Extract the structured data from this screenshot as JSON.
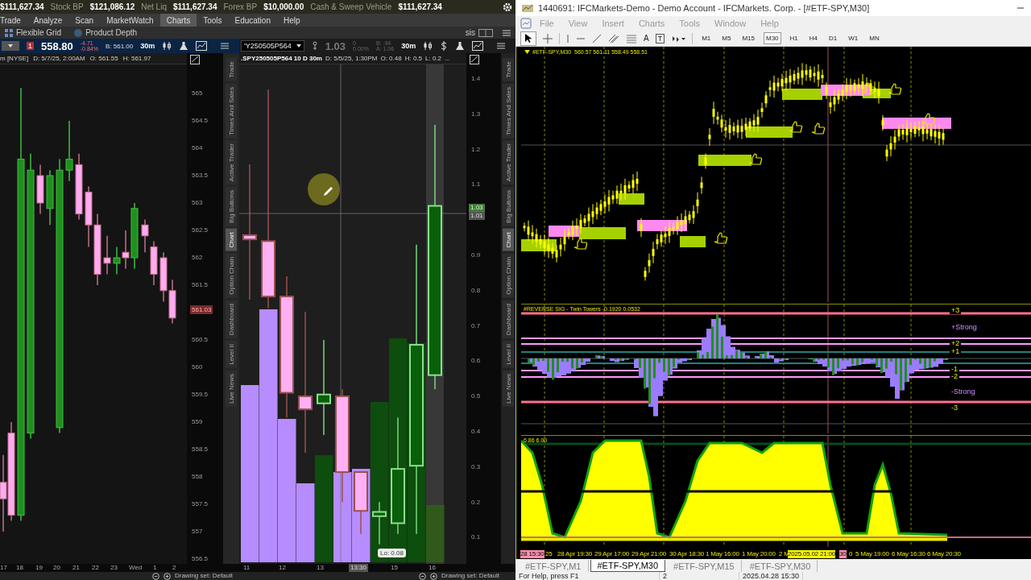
{
  "account_bar": {
    "items": [
      {
        "value": "$111,627.34"
      },
      {
        "label": "Stock BP",
        "value": "$121,086.12"
      },
      {
        "label": "Net Liq",
        "value": "$111,627.34"
      },
      {
        "label": "Forex BP",
        "value": "$10,000.00"
      },
      {
        "label": "Cash & Sweep Vehicle",
        "value": "$111,627.34"
      }
    ]
  },
  "main_menu": [
    {
      "label": "Trade",
      "selected": false
    },
    {
      "label": "Analyze",
      "selected": false
    },
    {
      "label": "Scan",
      "selected": false
    },
    {
      "label": "MarketWatch",
      "selected": false
    },
    {
      "label": "Charts",
      "selected": true
    },
    {
      "label": "Tools",
      "selected": false
    },
    {
      "label": "Education",
      "selected": false
    },
    {
      "label": "Help",
      "selected": false
    }
  ],
  "sub_toolbar": {
    "items": [
      "Flexible Grid",
      "Product Depth"
    ],
    "right_label": "sis"
  },
  "left_chart": {
    "toolbar": {
      "alert_badge": "1",
      "price": "558.80",
      "change": "-4.71",
      "change_pct": "-0.84%",
      "bid": "B: 561.00",
      "timeframe": "30m"
    },
    "header": [
      "m [NYSE]",
      "D: 5/7/25, 2:00AM",
      "O: 561.55",
      "H: 561.97"
    ],
    "price_axis": [
      "565",
      "564.5",
      "564",
      "563.5",
      "563",
      "562.5",
      "562",
      "561.5",
      "560.5",
      "560",
      "559.5",
      "559",
      "558.5",
      "558",
      "557.5",
      "557",
      "556.5"
    ],
    "last_price": "561.03",
    "time_axis": [
      "17",
      "18",
      "19",
      "20",
      "21",
      "22",
      "23",
      "Wed",
      "1",
      "2"
    ],
    "drawing_set": "Drawing set: Default"
  },
  "side_tabs_left": [
    {
      "label": "Trade",
      "selected": false
    },
    {
      "label": "Times And Sales",
      "selected": false
    },
    {
      "label": "Active Trader",
      "selected": false
    },
    {
      "label": "Big Buttons",
      "selected": false
    },
    {
      "label": "Chart",
      "selected": true
    },
    {
      "label": "Option Chain",
      "selected": false
    },
    {
      "label": "Dashboard",
      "selected": false
    },
    {
      "label": "Level II",
      "selected": false
    },
    {
      "label": "Live News",
      "selected": false
    }
  ],
  "option_chart": {
    "toolbar": {
      "symbol": "'Y250505P564",
      "price": "1.03",
      "change": "0",
      "change_pct": "0.00%",
      "bid": "B: .94",
      "ask": "A: 1.06",
      "timeframe": "30m"
    },
    "header": [
      ".SPY250505P564 10 D 30m",
      "D: 5/5/25, 1:30PM",
      "O: 0.48",
      "H: 0.5",
      "L: 0.2",
      "..."
    ],
    "price_axis": [
      "1.4",
      "1.3",
      "1.2",
      "1.1",
      "0.9",
      "0.8",
      "0.7",
      "0.6",
      "0.5",
      "0.4",
      "0.3",
      "0.2",
      "0.1"
    ],
    "last_price": "1.03",
    "cursor_price": "1.01",
    "low_tooltip": "Lo: 0.08",
    "time_axis": [
      {
        "label": "11",
        "selected": false
      },
      {
        "label": "12",
        "selected": false
      },
      {
        "label": "13",
        "selected": false
      },
      {
        "label": "13:30",
        "selected": true
      },
      {
        "label": "15",
        "selected": false
      },
      {
        "label": "16",
        "selected": false
      }
    ],
    "drawing_set": "Drawing set: Default"
  },
  "side_tabs_right": [
    {
      "label": "Trade",
      "selected": false
    },
    {
      "label": "Times And Sales",
      "selected": false
    },
    {
      "label": "Active Trader",
      "selected": false
    },
    {
      "label": "Big Buttons",
      "selected": false
    },
    {
      "label": "Chart",
      "selected": true
    },
    {
      "label": "Option Chain",
      "selected": false
    },
    {
      "label": "Dashboard",
      "selected": false
    },
    {
      "label": "Level II",
      "selected": false
    },
    {
      "label": "Live News",
      "selected": false
    }
  ],
  "mt4": {
    "title": "1440691: IFCMarkets-Demo - Demo Account - IFCMarkets. Corp. - [#ETF-SPY,M30]",
    "menu": [
      {
        "label": "File",
        "disabled": true
      },
      {
        "label": "View",
        "disabled": true
      },
      {
        "label": "Insert",
        "disabled": true
      },
      {
        "label": "Charts",
        "disabled": true
      },
      {
        "label": "Tools",
        "disabled": true
      },
      {
        "label": "Window",
        "disabled": true
      },
      {
        "label": "Help",
        "disabled": true
      }
    ],
    "toolbar": {
      "cursor_selected": true,
      "text_tool": "A",
      "label_tool": "T",
      "timeframes": [
        {
          "label": "M1",
          "selected": false
        },
        {
          "label": "M5",
          "selected": false
        },
        {
          "label": "M15",
          "selected": false
        },
        {
          "label": "M30",
          "selected": true
        },
        {
          "label": "H1",
          "selected": false
        },
        {
          "label": "H4",
          "selected": false
        },
        {
          "label": "D1",
          "selected": false
        },
        {
          "label": "W1",
          "selected": false
        },
        {
          "label": "MN",
          "selected": false
        }
      ]
    },
    "chart_header": "#ETF-SPY,M30  560.57 561.11 558.49 558.51",
    "indicator": {
      "title": "#REVERSE SIG - Twin Towers -0.1920 0.0532",
      "levels": [
        {
          "label": "+3",
          "kind": "level"
        },
        {
          "label": "+Strong",
          "kind": "zone"
        },
        {
          "label": "+2",
          "kind": "level"
        },
        {
          "label": "+1",
          "kind": "level"
        },
        {
          "label": "-1",
          "kind": "level"
        },
        {
          "label": "-2",
          "kind": "level"
        },
        {
          "label": "-Strong",
          "kind": "zone"
        },
        {
          "label": "-3",
          "kind": "level"
        }
      ]
    },
    "oscillator_label": "6.86 6.00",
    "time_axis": [
      {
        "label": "28 15:30",
        "kind": "start"
      },
      {
        "label": "25",
        "kind": "tick"
      },
      {
        "label": "28 Apr 19:30",
        "kind": "tick"
      },
      {
        "label": "29 Apr 17:00",
        "kind": "tick"
      },
      {
        "label": "29 Apr 21:00",
        "kind": "tick"
      },
      {
        "label": "30 Apr 18:30",
        "kind": "tick"
      },
      {
        "label": "1 May 16:00",
        "kind": "tick"
      },
      {
        "label": "1 May 20:00",
        "kind": "tick"
      },
      {
        "label": "2 M",
        "kind": "tick"
      },
      {
        "label": "2025.05.02 21:00",
        "kind": "cursor"
      },
      {
        "label": "30",
        "kind": "start"
      },
      {
        "label": "0",
        "kind": "tick"
      },
      {
        "label": "5 May 19:00",
        "kind": "tick"
      },
      {
        "label": "6 May 16:30",
        "kind": "tick"
      },
      {
        "label": "6 May 20:30",
        "kind": "tick"
      }
    ],
    "tabs": [
      {
        "label": "#ETF-SPY,M1",
        "selected": false
      },
      {
        "label": "#ETF-SPY,M30",
        "selected": true
      },
      {
        "label": "#ETF-SPY,M15",
        "selected": false
      },
      {
        "label": "#ETF-SPY,M30",
        "selected": false
      }
    ],
    "status_bar": [
      "For Help, press F1",
      "2",
      "2025.04.28 15:30"
    ]
  }
}
